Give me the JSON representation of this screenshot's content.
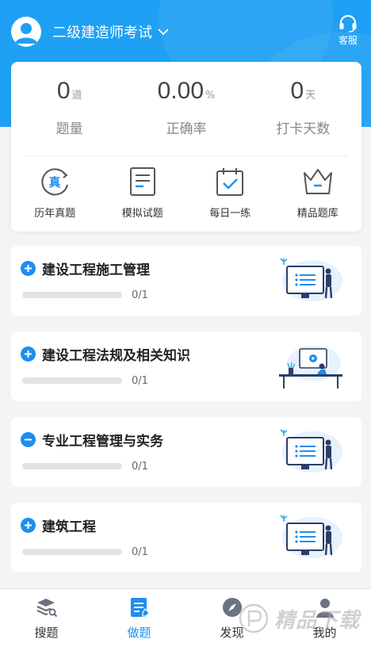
{
  "colors": {
    "primary": "#1ea0f4",
    "accent": "#1e8ef0",
    "background": "#f3f4f6"
  },
  "header": {
    "exam_title": "二级建造师考试",
    "service_label": "客服"
  },
  "stats": [
    {
      "value": "0",
      "unit": "道",
      "label": "题量"
    },
    {
      "value": "0.00",
      "unit": "%",
      "label": "正确率"
    },
    {
      "value": "0",
      "unit": "天",
      "label": "打卡天数"
    }
  ],
  "quick_actions": [
    {
      "label": "历年真题",
      "icon": "zhen-badge-icon"
    },
    {
      "label": "模拟试题",
      "icon": "document-icon"
    },
    {
      "label": "每日一练",
      "icon": "calendar-check-icon"
    },
    {
      "label": "精品题库",
      "icon": "crown-icon"
    }
  ],
  "subjects": [
    {
      "name": "建设工程施工管理",
      "progress": "0/1",
      "progress_fraction": 0,
      "expanded": false
    },
    {
      "name": "建设工程法规及相关知识",
      "progress": "0/1",
      "progress_fraction": 0,
      "expanded": false
    },
    {
      "name": "专业工程管理与实务",
      "progress": "0/1",
      "progress_fraction": 0,
      "expanded": true
    },
    {
      "name": "建筑工程",
      "progress": "0/1",
      "progress_fraction": 0,
      "expanded": false
    }
  ],
  "tabbar": [
    {
      "label": "搜题",
      "icon": "stack-search-icon",
      "active": false
    },
    {
      "label": "做题",
      "icon": "edit-doc-icon",
      "active": true
    },
    {
      "label": "发现",
      "icon": "compass-icon",
      "active": false
    },
    {
      "label": "我的",
      "icon": "person-icon",
      "active": false
    }
  ],
  "watermark": {
    "text": "精品下载"
  }
}
